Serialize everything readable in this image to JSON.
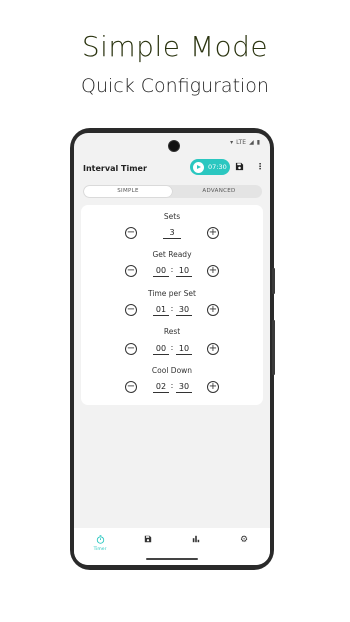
{
  "promo": {
    "headline": "Simple Mode",
    "subheadline": "Quick Configuration"
  },
  "status_bar": {
    "wifi_icon": "wifi-icon",
    "network": "LTE",
    "signal_icon": "signal-icon",
    "battery_icon": "battery-icon"
  },
  "app_bar": {
    "title": "Interval Timer",
    "total_time": "07:30",
    "play_icon": "play-icon",
    "save_icon": "save-icon",
    "more_icon": "more-vert-icon",
    "accent_color": "#2bc7c0"
  },
  "mode_tabs": {
    "simple": "SIMPLE",
    "advanced": "ADVANCED",
    "selected": "SIMPLE"
  },
  "settings": {
    "sets": {
      "label": "Sets",
      "value": "3"
    },
    "get_ready": {
      "label": "Get Ready",
      "minutes": "00",
      "seconds": "10"
    },
    "time_per_set": {
      "label": "Time per Set",
      "minutes": "01",
      "seconds": "30"
    },
    "rest": {
      "label": "Rest",
      "minutes": "00",
      "seconds": "10"
    },
    "cool_down": {
      "label": "Cool Down",
      "minutes": "02",
      "seconds": "30"
    },
    "separator": ":",
    "minus_symbol": "−",
    "plus_symbol": "+"
  },
  "bottom_nav": {
    "timer": {
      "label": "Timer",
      "icon": "stopwatch-icon"
    },
    "saved": {
      "icon": "save-icon"
    },
    "stats": {
      "icon": "bar-chart-icon"
    },
    "settings": {
      "icon": "gear-icon"
    }
  }
}
